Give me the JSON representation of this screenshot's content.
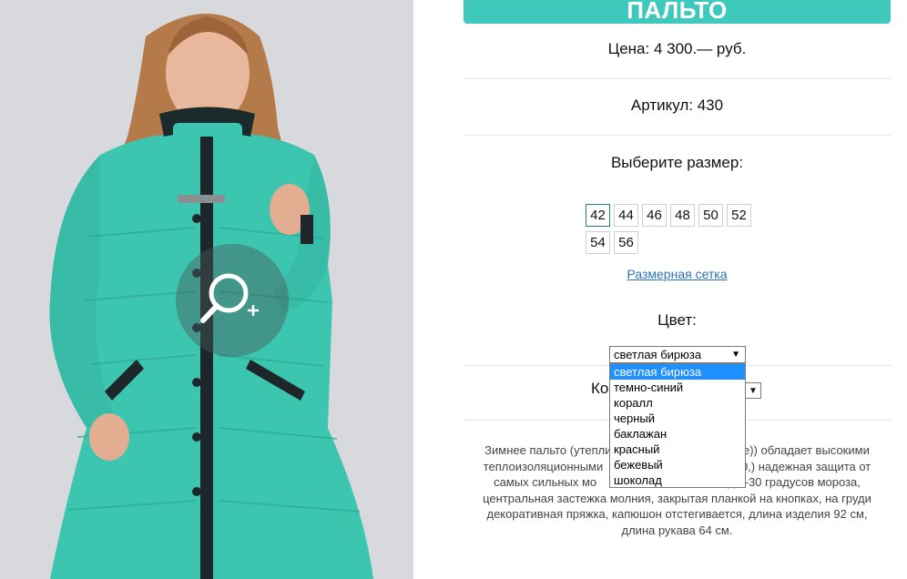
{
  "product": {
    "title": "ПАЛЬТО",
    "price": "Цена: 4 300.— руб.",
    "sku": "Артикул: 430",
    "size_prompt": "Выберите размер:",
    "sizes": [
      "42",
      "44",
      "46",
      "48",
      "50",
      "52",
      "54",
      "56"
    ],
    "selected_size": "42",
    "size_chart_link": "Размерная сетка",
    "color_label": "Цвет:",
    "color_selected": "светлая бирюза",
    "color_options": [
      "светлая бирюза",
      "темно-синий",
      "коралл",
      "черный",
      "баклажан",
      "красный",
      "бежевый",
      "шоколад"
    ],
    "quantity_label_partial": "Ко",
    "description": "Зимнее пальто (утепли                                        е)) обладает высокими теплоизоляционными                                        00,) надежная защита от самых сильных мо                                жим до -30 градусов мороза, центральная застежка молния, закрытая планкой на кнопках, на груди декоративная пряжка, капюшон отстегивается, длина изделия 92 см, длина рукава 64 см."
  },
  "colors": {
    "accent": "#3fc9bd",
    "coat": "#3cc6b0",
    "link": "#2b73b6",
    "selection": "#1e90ff"
  },
  "icons": {
    "zoom": "zoom-in-icon",
    "select_arrow": "dropdown-arrow-icon"
  }
}
